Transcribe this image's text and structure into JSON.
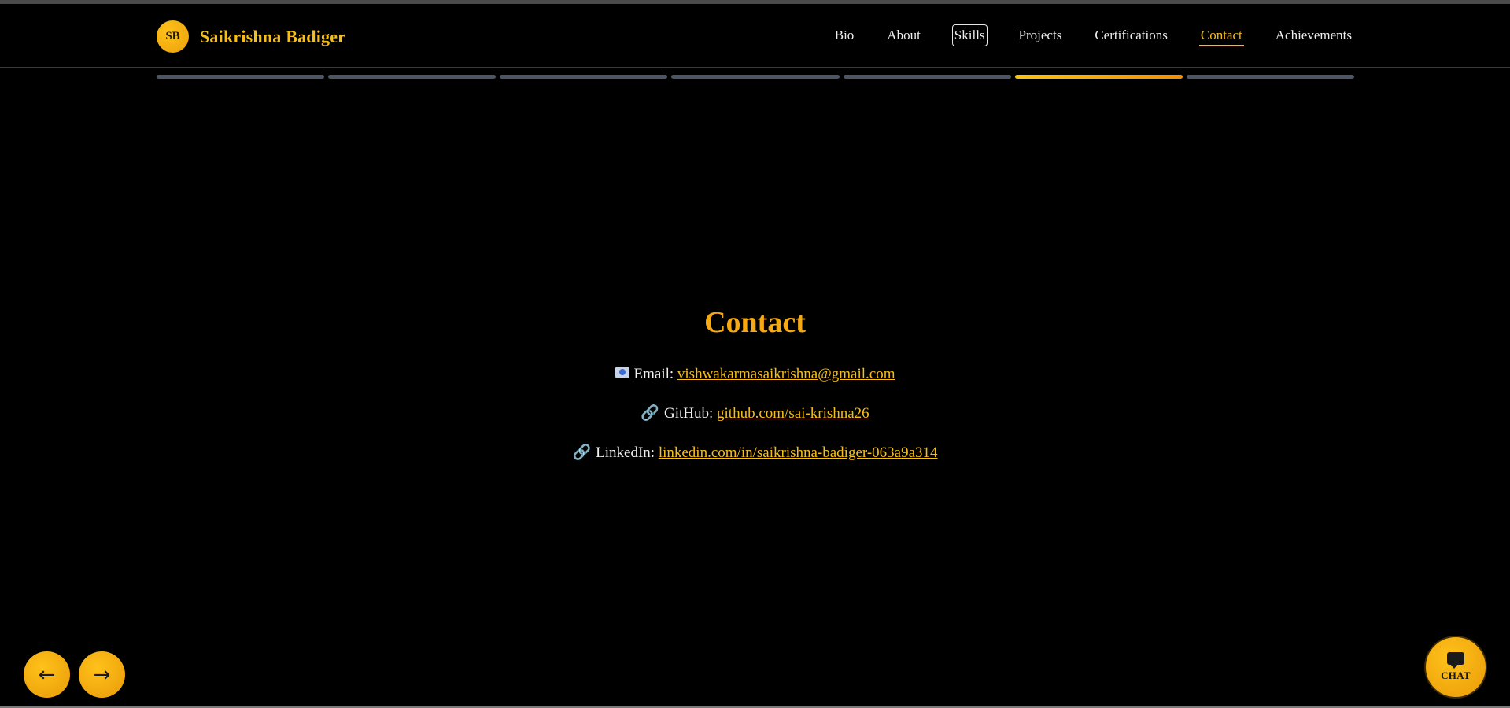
{
  "brand": {
    "initials": "SB",
    "name": "Saikrishna Badiger"
  },
  "nav": {
    "items": [
      {
        "label": "Bio"
      },
      {
        "label": "About"
      },
      {
        "label": "Skills"
      },
      {
        "label": "Projects"
      },
      {
        "label": "Certifications"
      },
      {
        "label": "Contact"
      },
      {
        "label": "Achievements"
      }
    ],
    "active_index": 5,
    "focused_index": 2
  },
  "progress": {
    "segment_count": 7,
    "active_segment": 6
  },
  "contact": {
    "title": "Contact",
    "email": {
      "icon": "email-icon",
      "label": "Email:",
      "value": "vishwakarmasaikrishna@gmail.com"
    },
    "github": {
      "icon": "link-icon",
      "label": "GitHub:",
      "value": "github.com/sai-krishna26"
    },
    "linkedin": {
      "icon": "link-icon",
      "label": "LinkedIn:",
      "value": "linkedin.com/in/saikrishna-badiger-063a9a314"
    }
  },
  "controls": {
    "prev_label": "←",
    "next_label": "→",
    "chat_label": "CHAT"
  },
  "colors": {
    "accent": "#f5be1a",
    "accent_dark": "#ef8f0a",
    "title": "#f5a914",
    "background": "#000000",
    "inactive_segment": "#4b5563"
  }
}
